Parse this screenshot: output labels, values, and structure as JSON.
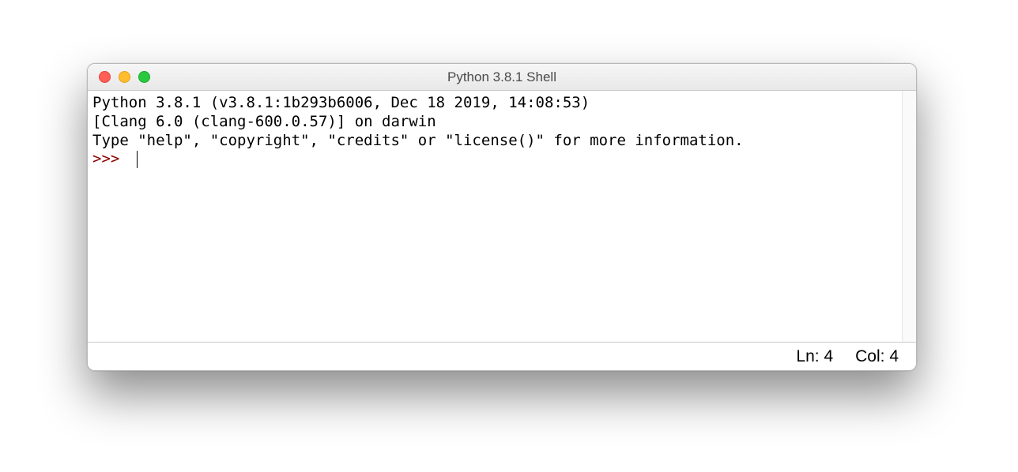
{
  "window": {
    "title": "Python 3.8.1 Shell"
  },
  "shell": {
    "line1": "Python 3.8.1 (v3.8.1:1b293b6006, Dec 18 2019, 14:08:53) ",
    "line2": "[Clang 6.0 (clang-600.0.57)] on darwin",
    "line3": "Type \"help\", \"copyright\", \"credits\" or \"license()\" for more information.",
    "prompt": ">>> "
  },
  "status": {
    "ln": "Ln: 4",
    "col": "Col: 4"
  }
}
